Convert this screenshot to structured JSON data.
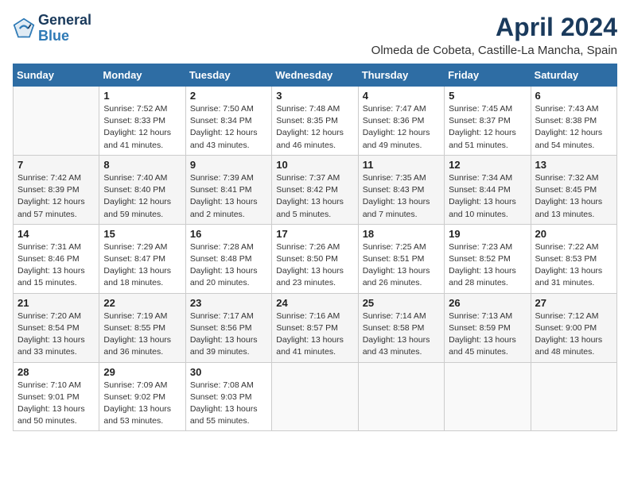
{
  "header": {
    "logo_line1": "General",
    "logo_line2": "Blue",
    "title": "April 2024",
    "subtitle": "Olmeda de Cobeta, Castille-La Mancha, Spain"
  },
  "weekdays": [
    "Sunday",
    "Monday",
    "Tuesday",
    "Wednesday",
    "Thursday",
    "Friday",
    "Saturday"
  ],
  "weeks": [
    [
      {
        "day": "",
        "info": ""
      },
      {
        "day": "1",
        "info": "Sunrise: 7:52 AM\nSunset: 8:33 PM\nDaylight: 12 hours\nand 41 minutes."
      },
      {
        "day": "2",
        "info": "Sunrise: 7:50 AM\nSunset: 8:34 PM\nDaylight: 12 hours\nand 43 minutes."
      },
      {
        "day": "3",
        "info": "Sunrise: 7:48 AM\nSunset: 8:35 PM\nDaylight: 12 hours\nand 46 minutes."
      },
      {
        "day": "4",
        "info": "Sunrise: 7:47 AM\nSunset: 8:36 PM\nDaylight: 12 hours\nand 49 minutes."
      },
      {
        "day": "5",
        "info": "Sunrise: 7:45 AM\nSunset: 8:37 PM\nDaylight: 12 hours\nand 51 minutes."
      },
      {
        "day": "6",
        "info": "Sunrise: 7:43 AM\nSunset: 8:38 PM\nDaylight: 12 hours\nand 54 minutes."
      }
    ],
    [
      {
        "day": "7",
        "info": "Sunrise: 7:42 AM\nSunset: 8:39 PM\nDaylight: 12 hours\nand 57 minutes."
      },
      {
        "day": "8",
        "info": "Sunrise: 7:40 AM\nSunset: 8:40 PM\nDaylight: 12 hours\nand 59 minutes."
      },
      {
        "day": "9",
        "info": "Sunrise: 7:39 AM\nSunset: 8:41 PM\nDaylight: 13 hours\nand 2 minutes."
      },
      {
        "day": "10",
        "info": "Sunrise: 7:37 AM\nSunset: 8:42 PM\nDaylight: 13 hours\nand 5 minutes."
      },
      {
        "day": "11",
        "info": "Sunrise: 7:35 AM\nSunset: 8:43 PM\nDaylight: 13 hours\nand 7 minutes."
      },
      {
        "day": "12",
        "info": "Sunrise: 7:34 AM\nSunset: 8:44 PM\nDaylight: 13 hours\nand 10 minutes."
      },
      {
        "day": "13",
        "info": "Sunrise: 7:32 AM\nSunset: 8:45 PM\nDaylight: 13 hours\nand 13 minutes."
      }
    ],
    [
      {
        "day": "14",
        "info": "Sunrise: 7:31 AM\nSunset: 8:46 PM\nDaylight: 13 hours\nand 15 minutes."
      },
      {
        "day": "15",
        "info": "Sunrise: 7:29 AM\nSunset: 8:47 PM\nDaylight: 13 hours\nand 18 minutes."
      },
      {
        "day": "16",
        "info": "Sunrise: 7:28 AM\nSunset: 8:48 PM\nDaylight: 13 hours\nand 20 minutes."
      },
      {
        "day": "17",
        "info": "Sunrise: 7:26 AM\nSunset: 8:50 PM\nDaylight: 13 hours\nand 23 minutes."
      },
      {
        "day": "18",
        "info": "Sunrise: 7:25 AM\nSunset: 8:51 PM\nDaylight: 13 hours\nand 26 minutes."
      },
      {
        "day": "19",
        "info": "Sunrise: 7:23 AM\nSunset: 8:52 PM\nDaylight: 13 hours\nand 28 minutes."
      },
      {
        "day": "20",
        "info": "Sunrise: 7:22 AM\nSunset: 8:53 PM\nDaylight: 13 hours\nand 31 minutes."
      }
    ],
    [
      {
        "day": "21",
        "info": "Sunrise: 7:20 AM\nSunset: 8:54 PM\nDaylight: 13 hours\nand 33 minutes."
      },
      {
        "day": "22",
        "info": "Sunrise: 7:19 AM\nSunset: 8:55 PM\nDaylight: 13 hours\nand 36 minutes."
      },
      {
        "day": "23",
        "info": "Sunrise: 7:17 AM\nSunset: 8:56 PM\nDaylight: 13 hours\nand 39 minutes."
      },
      {
        "day": "24",
        "info": "Sunrise: 7:16 AM\nSunset: 8:57 PM\nDaylight: 13 hours\nand 41 minutes."
      },
      {
        "day": "25",
        "info": "Sunrise: 7:14 AM\nSunset: 8:58 PM\nDaylight: 13 hours\nand 43 minutes."
      },
      {
        "day": "26",
        "info": "Sunrise: 7:13 AM\nSunset: 8:59 PM\nDaylight: 13 hours\nand 45 minutes."
      },
      {
        "day": "27",
        "info": "Sunrise: 7:12 AM\nSunset: 9:00 PM\nDaylight: 13 hours\nand 48 minutes."
      }
    ],
    [
      {
        "day": "28",
        "info": "Sunrise: 7:10 AM\nSunset: 9:01 PM\nDaylight: 13 hours\nand 50 minutes."
      },
      {
        "day": "29",
        "info": "Sunrise: 7:09 AM\nSunset: 9:02 PM\nDaylight: 13 hours\nand 53 minutes."
      },
      {
        "day": "30",
        "info": "Sunrise: 7:08 AM\nSunset: 9:03 PM\nDaylight: 13 hours\nand 55 minutes."
      },
      {
        "day": "",
        "info": ""
      },
      {
        "day": "",
        "info": ""
      },
      {
        "day": "",
        "info": ""
      },
      {
        "day": "",
        "info": ""
      }
    ]
  ]
}
